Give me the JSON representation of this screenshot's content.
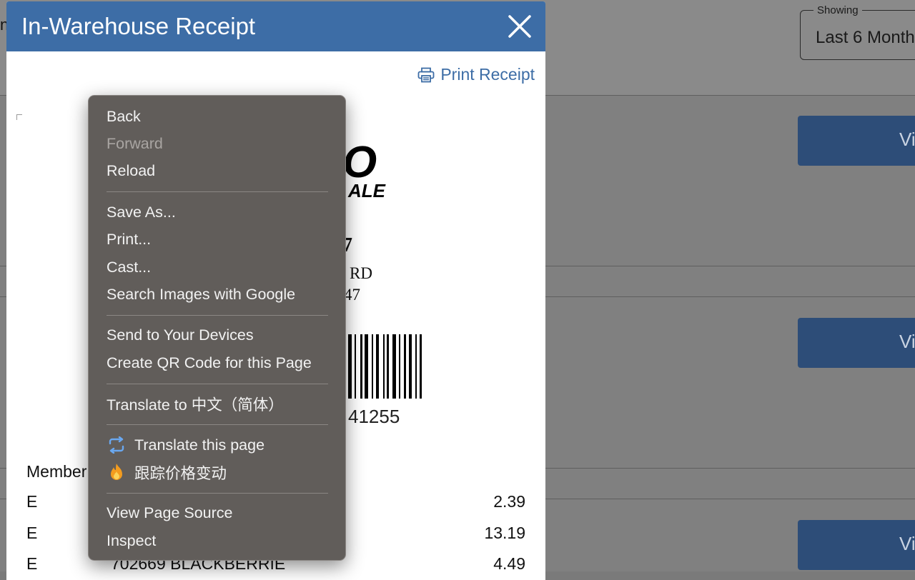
{
  "background": {
    "edge_text": "n",
    "showing": {
      "legend": "Showing",
      "value": "Last 6 Month"
    },
    "view_buttons": [
      "Vi",
      "Vi",
      "Vi"
    ]
  },
  "modal": {
    "title": "In-Warehouse Receipt",
    "print_label": "Print Receipt",
    "receipt": {
      "logo_fragment_1": "O",
      "logo_fragment_2": "ALE",
      "store_num_fragment": "7",
      "address_fragment": "RD",
      "city_fragment": "47",
      "barcode_number_fragment": "41255",
      "member_label": "Member",
      "rows": [
        {
          "code": "E",
          "item": "",
          "price": "2.39"
        },
        {
          "code": "E",
          "item": "",
          "price": "13.19"
        },
        {
          "code": "E",
          "item": "702669   BLACKBERRIE",
          "price": "4.49"
        }
      ]
    }
  },
  "context_menu": {
    "groups": [
      [
        {
          "label": "Back",
          "enabled": true
        },
        {
          "label": "Forward",
          "enabled": false
        },
        {
          "label": "Reload",
          "enabled": true
        }
      ],
      [
        {
          "label": "Save As...",
          "enabled": true
        },
        {
          "label": "Print...",
          "enabled": true
        },
        {
          "label": "Cast...",
          "enabled": true
        },
        {
          "label": "Search Images with Google",
          "enabled": true
        }
      ],
      [
        {
          "label": "Send to Your Devices",
          "enabled": true
        },
        {
          "label": "Create QR Code for this Page",
          "enabled": true
        }
      ],
      [
        {
          "label": "Translate to 中文（简体）",
          "enabled": true
        }
      ],
      [
        {
          "label": "Translate this page",
          "enabled": true,
          "icon": "translate-icon"
        },
        {
          "label": "跟踪价格变动",
          "enabled": true,
          "icon": "fire-icon"
        }
      ],
      [
        {
          "label": "View Page Source",
          "enabled": true
        },
        {
          "label": "Inspect",
          "enabled": true
        }
      ]
    ]
  },
  "colors": {
    "header_blue": "#3d6da6",
    "menu_bg": "#615d5a",
    "view_button": "#2d4d78"
  }
}
